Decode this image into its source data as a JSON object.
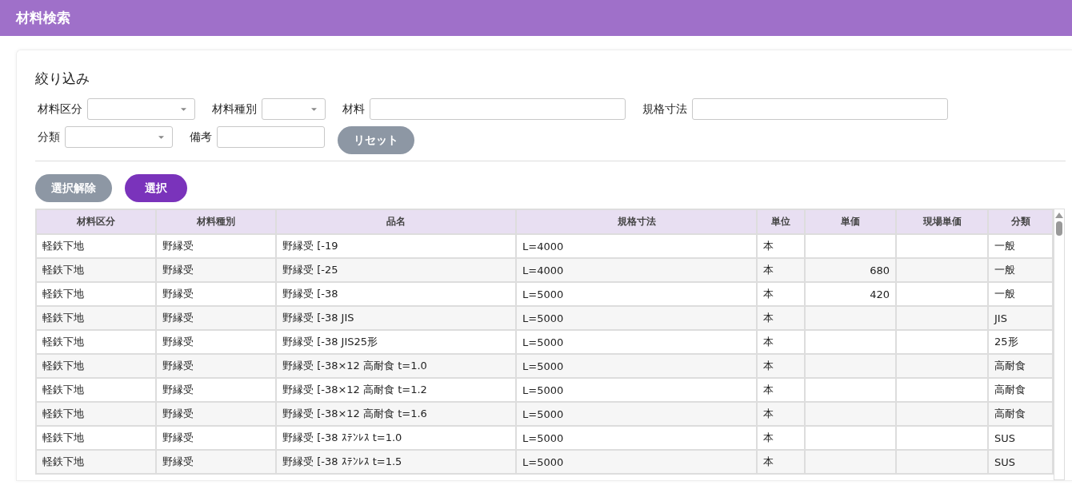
{
  "header": {
    "title": "材料検索"
  },
  "filter": {
    "title": "絞り込み",
    "rows": [
      [
        {
          "label": "材料区分",
          "kind": "select"
        },
        {
          "label": "材料種別",
          "kind": "select"
        },
        {
          "label": "材料",
          "kind": "text"
        },
        {
          "label": "規格寸法",
          "kind": "text"
        }
      ],
      [
        {
          "label": "分類",
          "kind": "select"
        },
        {
          "label": "備考",
          "kind": "text"
        },
        {
          "label": "リセット",
          "kind": "button"
        }
      ]
    ]
  },
  "actions": [
    {
      "label": "選択解除",
      "kind": "secondary"
    },
    {
      "label": "選択",
      "kind": "primary"
    }
  ],
  "table": {
    "columns": [
      {
        "label": "材料区分",
        "kind": "text"
      },
      {
        "label": "材料種別",
        "kind": "text"
      },
      {
        "label": "品名",
        "kind": "text"
      },
      {
        "label": "規格寸法",
        "kind": "text"
      },
      {
        "label": "単位",
        "kind": "text"
      },
      {
        "label": "単価",
        "kind": "number"
      },
      {
        "label": "現場単価",
        "kind": "number"
      },
      {
        "label": "分類",
        "kind": "text"
      }
    ],
    "rows": [
      [
        "軽鉄下地",
        "野縁受",
        "野縁受 [-19",
        "L=4000",
        "本",
        "",
        "",
        "一般"
      ],
      [
        "軽鉄下地",
        "野縁受",
        "野縁受 [-25",
        "L=4000",
        "本",
        "680",
        "",
        "一般"
      ],
      [
        "軽鉄下地",
        "野縁受",
        "野縁受 [-38",
        "L=5000",
        "本",
        "420",
        "",
        "一般"
      ],
      [
        "軽鉄下地",
        "野縁受",
        "野縁受 [-38 JIS",
        "L=5000",
        "本",
        "",
        "",
        "JIS"
      ],
      [
        "軽鉄下地",
        "野縁受",
        "野縁受 [-38 JIS25形",
        "L=5000",
        "本",
        "",
        "",
        "25形"
      ],
      [
        "軽鉄下地",
        "野縁受",
        "野縁受 [-38×12 高耐食 t=1.0",
        "L=5000",
        "本",
        "",
        "",
        "高耐食"
      ],
      [
        "軽鉄下地",
        "野縁受",
        "野縁受 [-38×12 高耐食 t=1.2",
        "L=5000",
        "本",
        "",
        "",
        "高耐食"
      ],
      [
        "軽鉄下地",
        "野縁受",
        "野縁受 [-38×12 高耐食 t=1.6",
        "L=5000",
        "本",
        "",
        "",
        "高耐食"
      ],
      [
        "軽鉄下地",
        "野縁受",
        "野縁受 [-38 ｽﾃﾝﾚｽ t=1.0",
        "L=5000",
        "本",
        "",
        "",
        "SUS"
      ],
      [
        "軽鉄下地",
        "野縁受",
        "野縁受 [-38 ｽﾃﾝﾚｽ t=1.5",
        "L=5000",
        "本",
        "",
        "",
        "SUS"
      ]
    ]
  }
}
